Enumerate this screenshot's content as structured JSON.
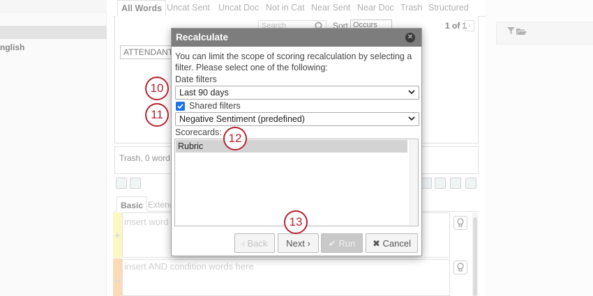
{
  "left_panel": {
    "language_label": "nglish"
  },
  "word_tabs": [
    {
      "label": "All Words"
    },
    {
      "label": "Uncat Sent"
    },
    {
      "label": "Uncat Doc"
    },
    {
      "label": "Not in Cat"
    },
    {
      "label": "Near Sent"
    },
    {
      "label": "Near Doc"
    },
    {
      "label": "Trash"
    },
    {
      "label": "Structured"
    }
  ],
  "word_list": {
    "search_placeholder": "Search",
    "sort_label": "Sort",
    "sort_value": "Occurs",
    "page_text": "1 of 1",
    "selected_word": "ATTENDANT"
  },
  "trash_text": "Trash, 0 word",
  "rule_tabs": {
    "basic": "Basic",
    "extended": "Extend"
  },
  "conditions": [
    {
      "placeholder": "insert word"
    },
    {
      "placeholder": "insert AND condition words here"
    }
  ],
  "dialog": {
    "title": "Recalculate",
    "description": "You can limit the scope of scoring recalculation by selecting a filter. Please select one of the following:",
    "date_filters_label": "Date filters",
    "date_filter_value": "Last 90 days",
    "shared_filters_label": "Shared filters",
    "shared_filters_checked": true,
    "shared_filter_value": "Negative Sentiment (predefined)",
    "scorecards_label": "Scorecards:",
    "scorecards": [
      "Rubric"
    ],
    "buttons": {
      "back": "Back",
      "next": "Next",
      "run": "Run",
      "cancel": "Cancel"
    }
  },
  "callouts": [
    "10",
    "11",
    "12",
    "13"
  ],
  "colors": {
    "callout": "#b8212e",
    "titlebar": "#7d7d7d",
    "checkbox": "#1a73e8",
    "selected_row": "#d3d3d3",
    "gutter_and": "#fbf3a6",
    "gutter_or": "#f8c891"
  },
  "icons": {
    "filter": "filter-icon",
    "folder": "folder-icon",
    "search": "search-icon",
    "close": "close-icon",
    "checkmark": "check-icon",
    "chevron_left": "chevron-left-icon",
    "chevron_right": "chevron-right-icon",
    "times": "times-icon",
    "lightbulb": "lightbulb-icon"
  }
}
